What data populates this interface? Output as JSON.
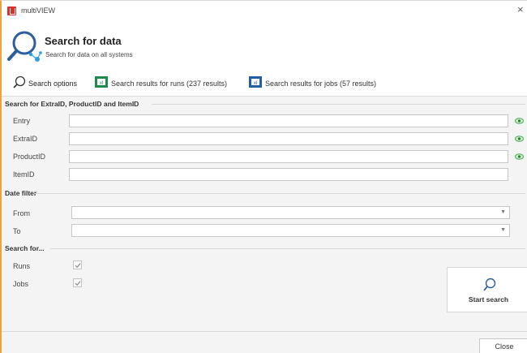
{
  "window": {
    "title": "multiVIEW",
    "close_glyph": "×",
    "app_icon": "multiview-logo-icon"
  },
  "header": {
    "title": "Search for data",
    "subtitle": "Search for data on all systems",
    "icon": "search-network-icon"
  },
  "tabs": [
    {
      "label": "Search options",
      "icon": "search-icon",
      "active": true
    },
    {
      "label": "Search results for runs (237 results)",
      "icon": "excel-runs-icon",
      "active": false
    },
    {
      "label": "Search results for jobs (57 results)",
      "icon": "excel-jobs-icon",
      "active": false
    }
  ],
  "ids_section": {
    "title": "Search for ExtraID, ProductID and ItemID",
    "fields": [
      {
        "label": "Entry",
        "value": "",
        "has_eye": true
      },
      {
        "label": "ExtraID",
        "value": "",
        "has_eye": true
      },
      {
        "label": "ProductID",
        "value": "",
        "has_eye": true
      },
      {
        "label": "ItemID",
        "value": "",
        "has_eye": false
      }
    ]
  },
  "date_section": {
    "title": "Date filter",
    "from_label": "From",
    "to_label": "To",
    "from_value": "",
    "to_value": ""
  },
  "search_for_section": {
    "title": "Search for...",
    "runs_label": "Runs",
    "jobs_label": "Jobs",
    "runs_checked": true,
    "jobs_checked": true
  },
  "start_search": {
    "label": "Start search"
  },
  "footer": {
    "close_label": "Close"
  },
  "colors": {
    "accent_border": "#f0a23a",
    "eye_green": "#4caf50",
    "tab_icon_green": "#1e8a4c",
    "tab_icon_blue": "#1f5fa8"
  }
}
